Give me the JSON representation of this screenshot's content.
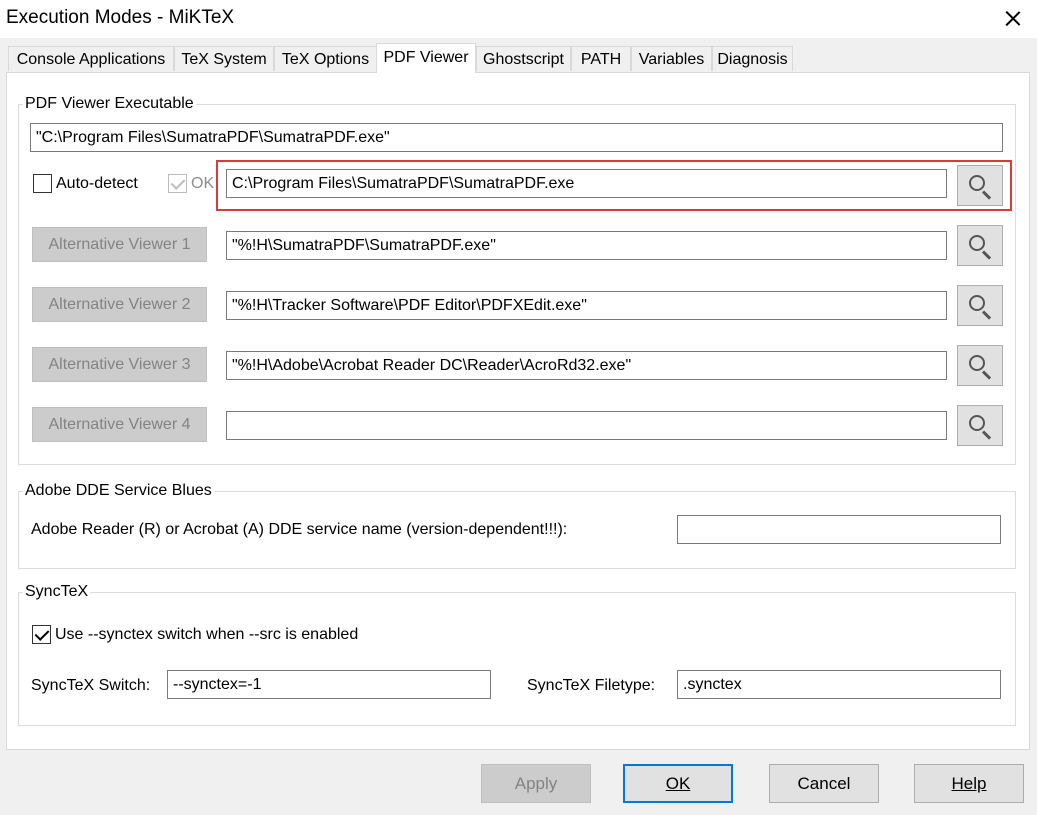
{
  "window": {
    "title": "Execution Modes - MiKTeX"
  },
  "tabs": [
    {
      "label": "Console Applications",
      "active": false
    },
    {
      "label": "TeX System",
      "active": false
    },
    {
      "label": "TeX Options",
      "active": false
    },
    {
      "label": "PDF Viewer",
      "active": true
    },
    {
      "label": "Ghostscript",
      "active": false
    },
    {
      "label": "PATH",
      "active": false
    },
    {
      "label": "Variables",
      "active": false
    },
    {
      "label": "Diagnosis",
      "active": false
    }
  ],
  "pdf_viewer": {
    "group_label": "PDF Viewer Executable",
    "executable_path": "\"C:\\Program Files\\SumatraPDF\\SumatraPDF.exe\"",
    "auto_detect_label": "Auto-detect",
    "auto_detect_checked": false,
    "ok_label": "OK",
    "ok_checked": true,
    "detected_path": "C:\\Program Files\\SumatraPDF\\SumatraPDF.exe",
    "alternatives": [
      {
        "label": "Alternative Viewer 1",
        "path": "\"%!H\\SumatraPDF\\SumatraPDF.exe\""
      },
      {
        "label": "Alternative Viewer 2",
        "path": "\"%!H\\Tracker Software\\PDF Editor\\PDFXEdit.exe\""
      },
      {
        "label": "Alternative Viewer 3",
        "path": "\"%!H\\Adobe\\Acrobat Reader DC\\Reader\\AcroRd32.exe\""
      },
      {
        "label": "Alternative Viewer 4",
        "path": ""
      }
    ]
  },
  "adobe_dde": {
    "group_label": "Adobe DDE Service Blues",
    "field_label": "Adobe Reader (R) or Acrobat (A) DDE service name  (version-dependent!!!):",
    "value": ""
  },
  "synctex": {
    "group_label": "SyncTeX",
    "use_switch_label": "Use --synctex switch when --src is enabled",
    "use_switch_checked": true,
    "switch_label": "SyncTeX Switch:",
    "switch_value": "--synctex=-1",
    "filetype_label": "SyncTeX Filetype:",
    "filetype_value": ".synctex"
  },
  "buttons": {
    "apply": "Apply",
    "ok": "OK",
    "cancel": "Cancel",
    "help": "Help"
  },
  "colors": {
    "highlight": "#d93a3a",
    "default_button_border": "#0078d7"
  }
}
